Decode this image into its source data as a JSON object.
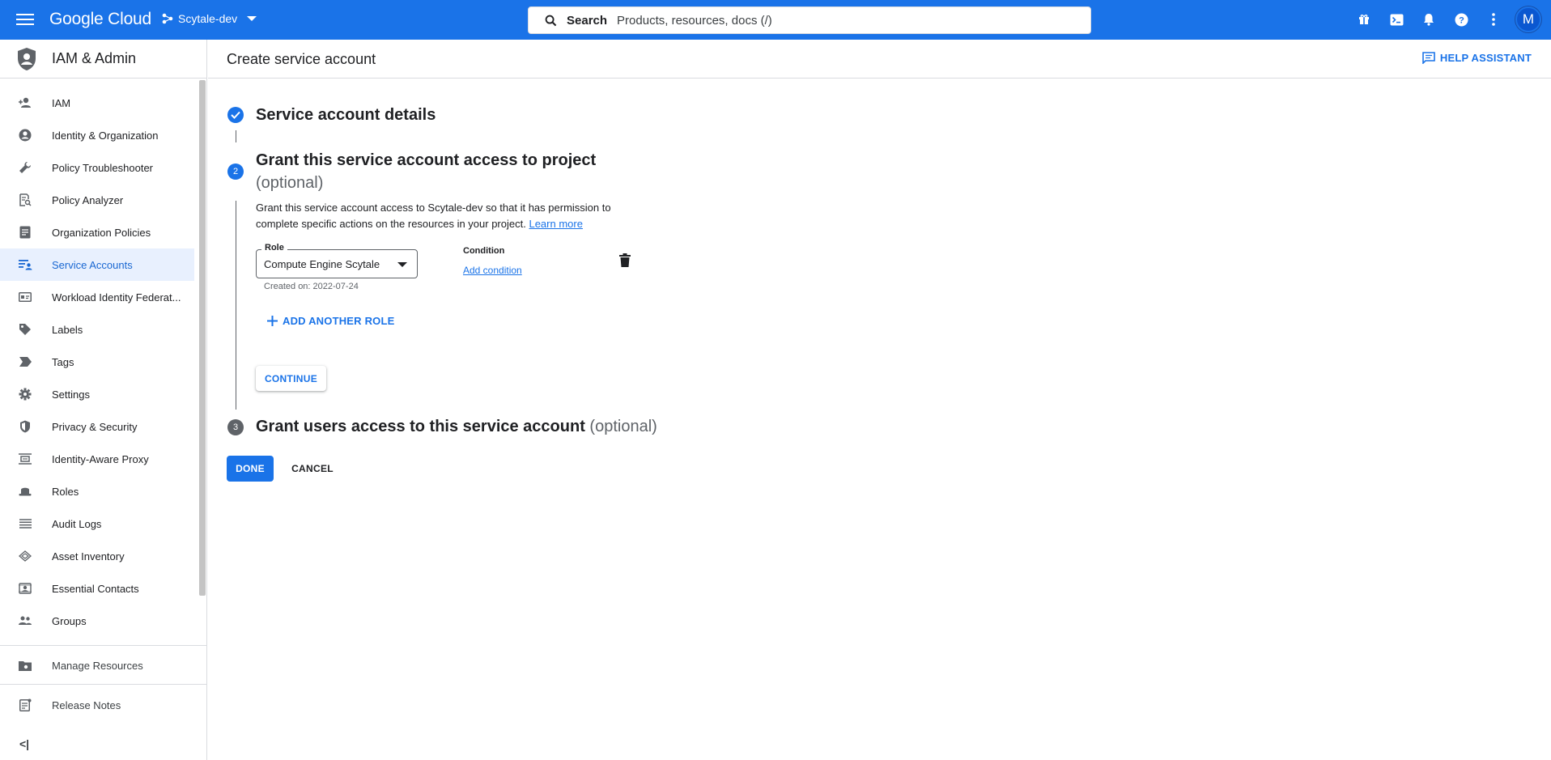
{
  "topbar": {
    "logo": "Google Cloud",
    "project": "Scytale-dev",
    "search_label": "Search",
    "search_placeholder": "Products, resources, docs (/)",
    "avatar_initial": "M"
  },
  "sidebar": {
    "title": "IAM & Admin",
    "items": [
      {
        "label": "IAM",
        "icon": "person-add-icon"
      },
      {
        "label": "Identity & Organization",
        "icon": "account-circle-icon"
      },
      {
        "label": "Policy Troubleshooter",
        "icon": "wrench-icon"
      },
      {
        "label": "Policy Analyzer",
        "icon": "document-search-icon"
      },
      {
        "label": "Organization Policies",
        "icon": "list-doc-icon"
      },
      {
        "label": "Service Accounts",
        "icon": "service-account-icon"
      },
      {
        "label": "Workload Identity Federat...",
        "icon": "id-card-icon"
      },
      {
        "label": "Labels",
        "icon": "label-icon"
      },
      {
        "label": "Tags",
        "icon": "tag-icon"
      },
      {
        "label": "Settings",
        "icon": "gear-icon"
      },
      {
        "label": "Privacy & Security",
        "icon": "shield-icon"
      },
      {
        "label": "Identity-Aware Proxy",
        "icon": "proxy-icon"
      },
      {
        "label": "Roles",
        "icon": "hat-icon"
      },
      {
        "label": "Audit Logs",
        "icon": "list-icon"
      },
      {
        "label": "Asset Inventory",
        "icon": "diamond-icon"
      },
      {
        "label": "Essential Contacts",
        "icon": "contact-icon"
      },
      {
        "label": "Groups",
        "icon": "group-icon"
      }
    ],
    "manage_resources": "Manage Resources",
    "release_notes": "Release Notes",
    "collapse": "<|"
  },
  "page": {
    "title": "Create service account",
    "help": "HELP ASSISTANT"
  },
  "steps": {
    "step1_title": "Service account details",
    "step2_number": "2",
    "step2_title": "Grant this service account access to project",
    "step2_optional": "(optional)",
    "step2_desc": "Grant this service account access to Scytale-dev so that it has permission to complete specific actions on the resources in your project.",
    "learn_more": "Learn more",
    "role_label": "Role",
    "role_value": "Compute Engine Scytale",
    "role_helper": "Created on: 2022-07-24",
    "condition_label": "Condition",
    "add_condition": "Add condition",
    "add_another_role": "ADD ANOTHER ROLE",
    "continue": "CONTINUE",
    "step3_number": "3",
    "step3_title": "Grant users access to this service account",
    "step3_optional": "(optional)"
  },
  "actions": {
    "done": "DONE",
    "cancel": "CANCEL"
  },
  "colors": {
    "brand": "#1a73e8",
    "active_bg": "#e8f0fe",
    "step3_icon": "#5f6368"
  }
}
